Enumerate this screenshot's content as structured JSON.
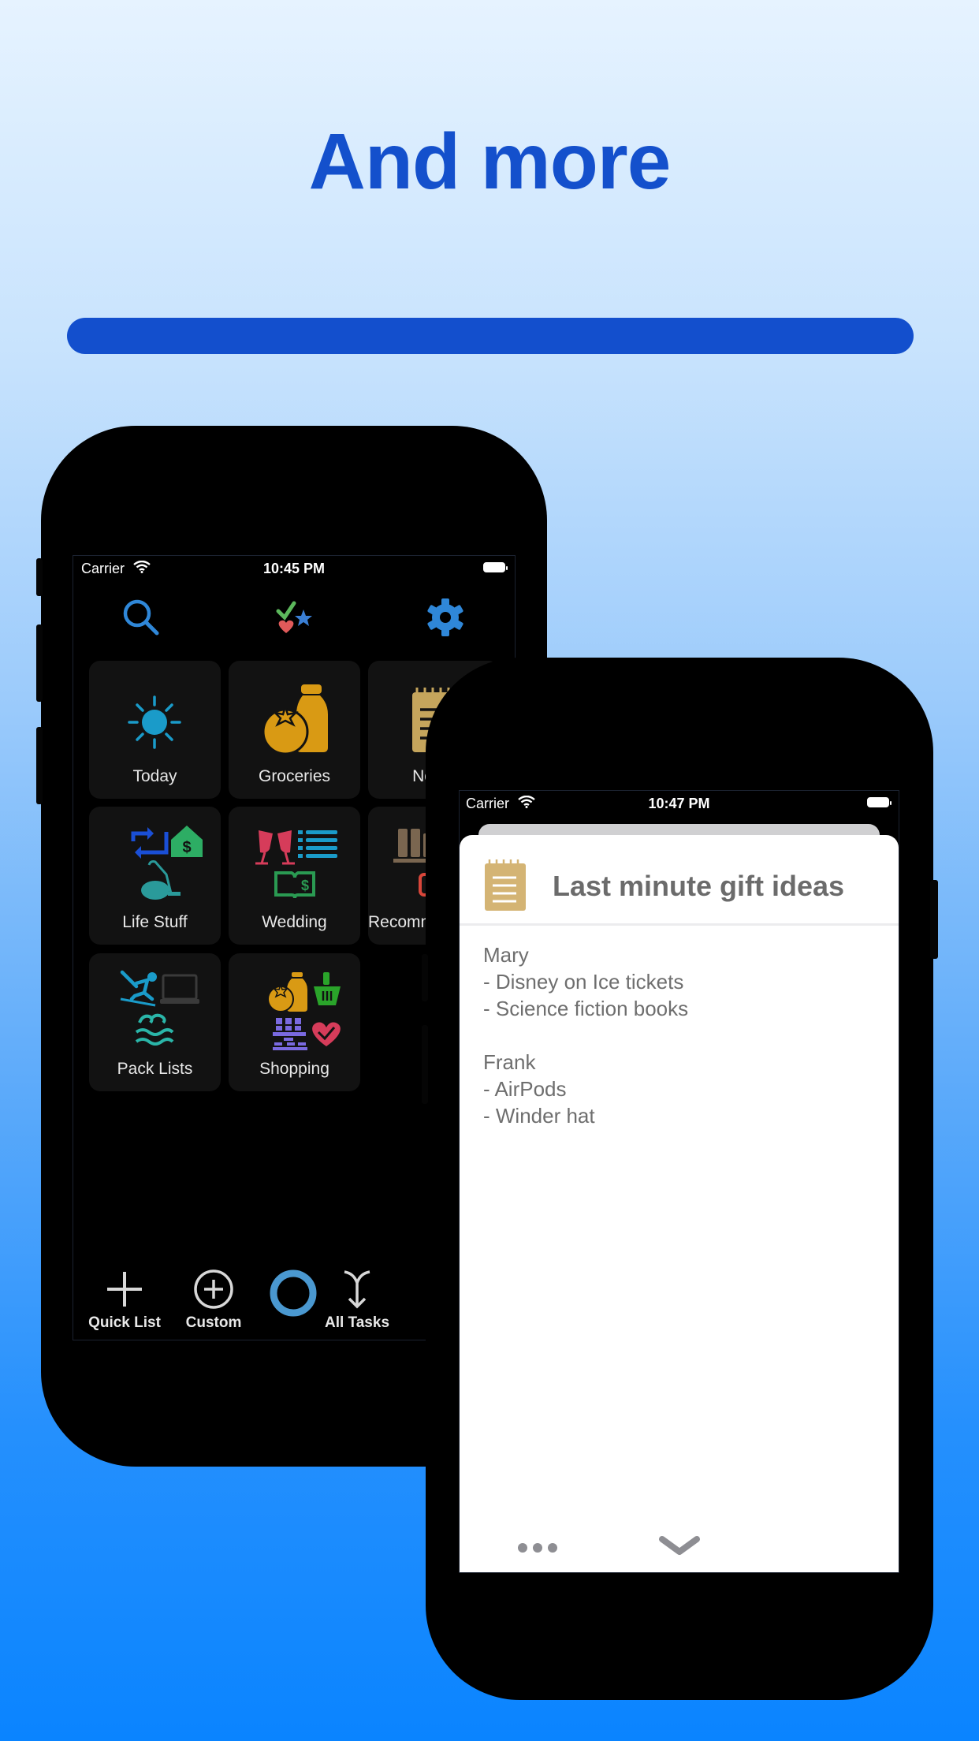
{
  "headline": "And more",
  "colors": {
    "accent": "#134fcd",
    "background_top": "#e6f3ff",
    "background_bottom": "#0a84ff",
    "tile_bg": "#121212",
    "note_icon": "#d4b474"
  },
  "left_phone": {
    "status_bar": {
      "carrier": "Carrier",
      "time": "10:45 PM",
      "wifi_icon": "wifi-icon",
      "battery_icon": "battery-icon"
    },
    "toolbar": {
      "left": {
        "icon": "search-icon"
      },
      "center": {
        "icon": "check-star-heart-icon"
      },
      "right": {
        "icon": "gear-icon"
      }
    },
    "tiles": [
      {
        "label": "Today",
        "icon": "sun-icon"
      },
      {
        "label": "Groceries",
        "icon": "tomato-bottle-icon"
      },
      {
        "label": "Notes",
        "icon": "notepad-icon"
      },
      {
        "label": "Life Stuff",
        "icon": "repeat-house-vacuum-icon"
      },
      {
        "label": "Wedding",
        "icon": "glasses-list-book-icon"
      },
      {
        "label": "Recommendations",
        "icon": "bookshelf-icon"
      },
      {
        "label": "Pack Lists",
        "icon": "ski-laptop-waves-icon"
      },
      {
        "label": "Shopping",
        "icon": "groceries-basket-heart-icon"
      }
    ],
    "bottom_bar": [
      {
        "label": "Quick List",
        "icon": "plus-icon"
      },
      {
        "label": "Custom",
        "icon": "plus-circle-icon"
      },
      {
        "label": "",
        "icon": "ring-icon"
      },
      {
        "label": "All Tasks",
        "icon": "merge-arrow-icon"
      }
    ]
  },
  "right_phone": {
    "status_bar": {
      "carrier": "Carrier",
      "time": "10:47 PM",
      "wifi_icon": "wifi-icon",
      "battery_icon": "battery-icon"
    },
    "note": {
      "icon": "notepad-icon",
      "title": "Last minute gift ideas",
      "body": "Mary\n- Disney on Ice tickets\n- Science fiction books\n\nFrank\n- AirPods\n- Winder hat"
    },
    "footer": [
      {
        "icon": "more-icon"
      },
      {
        "icon": "chevron-down-icon"
      }
    ]
  }
}
